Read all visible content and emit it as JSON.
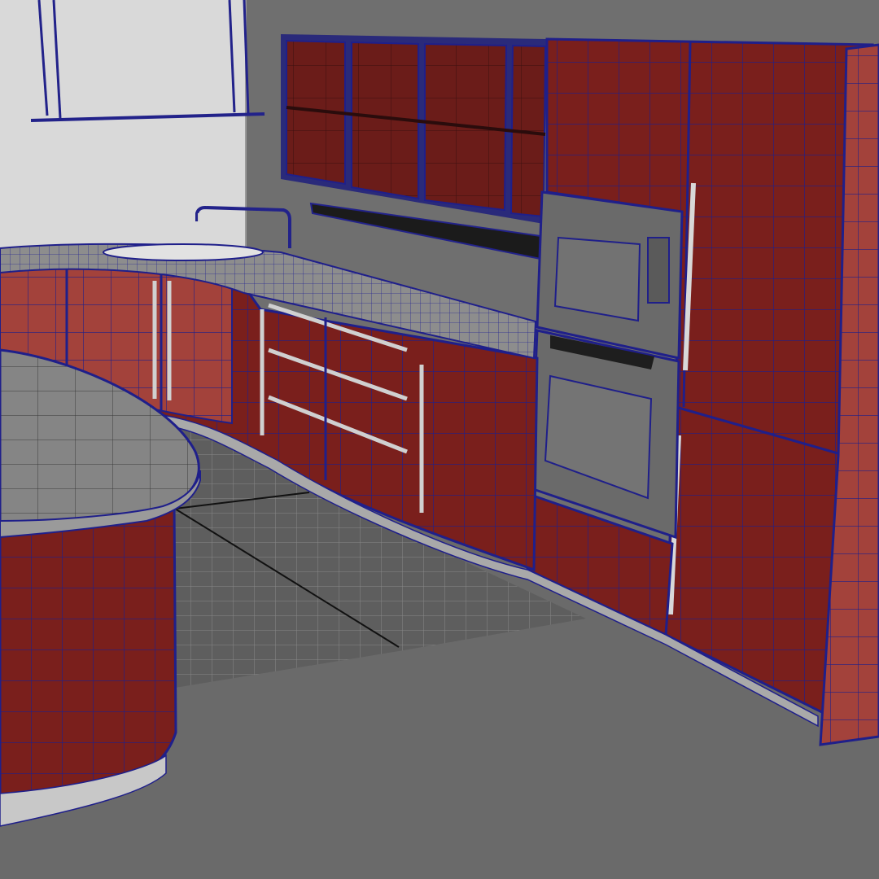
{
  "viewport": {
    "description_label": "",
    "colors": {
      "background_wall": "#6f6f6f",
      "left_wall": "#d9d9d9",
      "floor": "#6b6b6b",
      "floor_tile_area": "#5f5f5f",
      "cabinet_red": "#7a1f1c",
      "cabinet_red_light": "#a8463f",
      "wire_blue": "#1f1f8a",
      "countertop": "#8a8a8a",
      "metal": "#cfcfcf",
      "glass": "#707070"
    },
    "objects": [
      {
        "name": "pendant-light-frame"
      },
      {
        "name": "upper-glass-cabinets"
      },
      {
        "name": "wall-shelf"
      },
      {
        "name": "faucet"
      },
      {
        "name": "sink"
      },
      {
        "name": "base-cabinets-curved"
      },
      {
        "name": "drawer-stack"
      },
      {
        "name": "microwave"
      },
      {
        "name": "wall-oven"
      },
      {
        "name": "tall-pantry-cabinet"
      },
      {
        "name": "refrigerator-panel"
      },
      {
        "name": "kitchen-island"
      },
      {
        "name": "floor-tile-area"
      }
    ]
  }
}
